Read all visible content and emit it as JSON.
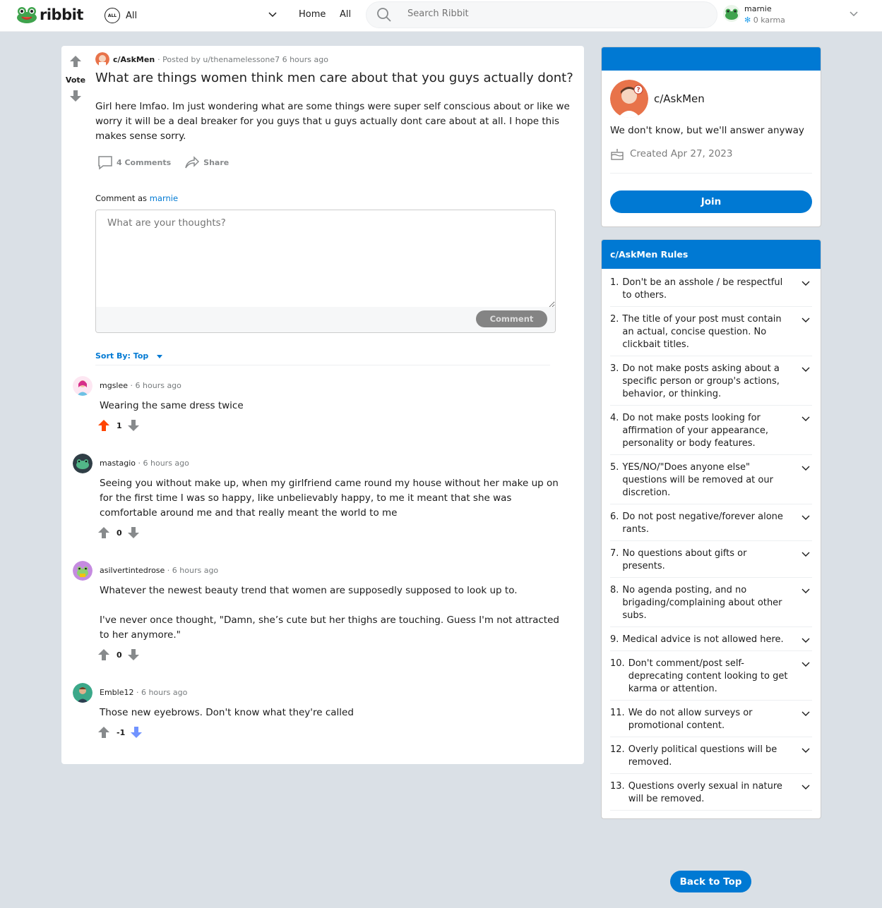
{
  "header": {
    "logo_text": "ribbit",
    "feed_badge": "ALL",
    "feed_label": "All",
    "nav": [
      "Home",
      "All"
    ],
    "search_placeholder": "Search Ribbit",
    "user": {
      "name": "marnie",
      "karma": "0 karma"
    }
  },
  "post": {
    "subreddit": "c/AskMen",
    "posted_by": "· Posted by u/thenamelessone7 6 hours ago",
    "vote_label": "Vote",
    "title": "What are things women think men care about that you guys actually dont?",
    "body": "Girl here lmfao. Im just wondering what are some things were super self conscious about or like we worry it will be a deal breaker for you guys that u guys actually dont care about at all. I hope this makes sense sorry.",
    "comments_label": "4 Comments",
    "share_label": "Share"
  },
  "comment_form": {
    "prefix": "Comment as ",
    "user": "marnie",
    "placeholder": "What are your thoughts?",
    "button": "Comment"
  },
  "sort": {
    "label": "Sort By: Top"
  },
  "comments": [
    {
      "author": "mgslee",
      "time": "· 6 hours ago",
      "lines": [
        "Wearing the same dress twice"
      ],
      "score": "1",
      "vote": "up"
    },
    {
      "author": "mastagio",
      "time": "· 6 hours ago",
      "lines": [
        "Seeing you without make up, when my girlfriend came round my house without her make up on for the first time I was so happy, like unbelievably happy, to me it meant that she was comfortable around me and that really meant the world to me"
      ],
      "score": "0",
      "vote": "none"
    },
    {
      "author": "asilvertintedrose",
      "time": "· 6 hours ago",
      "lines": [
        "Whatever the newest beauty trend that women are supposedly supposed to look up to.",
        "I've never once thought, \"Damn, she’s cute but her thighs are touching. Guess I'm not attracted to her anymore.\""
      ],
      "score": "0",
      "vote": "none"
    },
    {
      "author": "Emble12",
      "time": "· 6 hours ago",
      "lines": [
        "Those new eyebrows. Don't know what they're called"
      ],
      "score": "-1",
      "vote": "down"
    }
  ],
  "sidebar": {
    "name": "c/AskMen",
    "description": "We don't know, but we'll answer anyway",
    "created": "Created Apr 27, 2023",
    "join": "Join",
    "rules_title": "c/AskMen Rules",
    "rules": [
      {
        "num": "1.",
        "text": "Don't be an asshole / be respectful to others."
      },
      {
        "num": "2.",
        "text": "The title of your post must contain an actual, concise question. No clickbait titles."
      },
      {
        "num": "3.",
        "text": "Do not make posts asking about a specific person or group's actions, behavior, or thinking."
      },
      {
        "num": "4.",
        "text": "Do not make posts looking for affirmation of your appearance, personality or body features."
      },
      {
        "num": "5.",
        "text": "YES/NO/\"Does anyone else\" questions will be removed at our discretion."
      },
      {
        "num": "6.",
        "text": "Do not post negative/forever alone rants."
      },
      {
        "num": "7.",
        "text": "No questions about gifts or presents."
      },
      {
        "num": "8.",
        "text": "No agenda posting, and no brigading/complaining about other subs."
      },
      {
        "num": "9.",
        "text": "Medical advice is not allowed here."
      },
      {
        "num": "10.",
        "text": "Don't comment/post self-deprecating content looking to get karma or attention."
      },
      {
        "num": "11.",
        "text": "We do not allow surveys or promotional content."
      },
      {
        "num": "12.",
        "text": "Overly political questions will be removed."
      },
      {
        "num": "13.",
        "text": "Questions overly sexual in nature will be removed."
      }
    ]
  },
  "back_to_top": "Back to Top",
  "colors": {
    "accent": "#0079d3",
    "upvote": "#ff4500",
    "downvote": "#7193ff",
    "background": "#dae0e6"
  }
}
